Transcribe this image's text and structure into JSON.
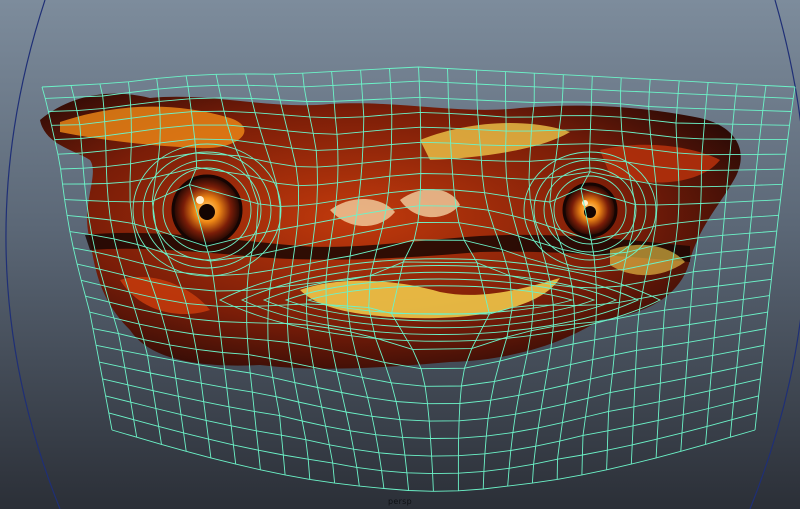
{
  "viewport": {
    "camera_label": "persp",
    "background_top": "#7d8c9c",
    "background_bottom": "#2b2f37"
  },
  "scene": {
    "mesh_color": "#6cf3c8",
    "arc_color": "#1f2f76",
    "texture_palette": [
      "#2a0c06",
      "#7a1d08",
      "#c23a0c",
      "#f08a16",
      "#f6d04c"
    ],
    "object": "painted-creature-face-texture"
  }
}
